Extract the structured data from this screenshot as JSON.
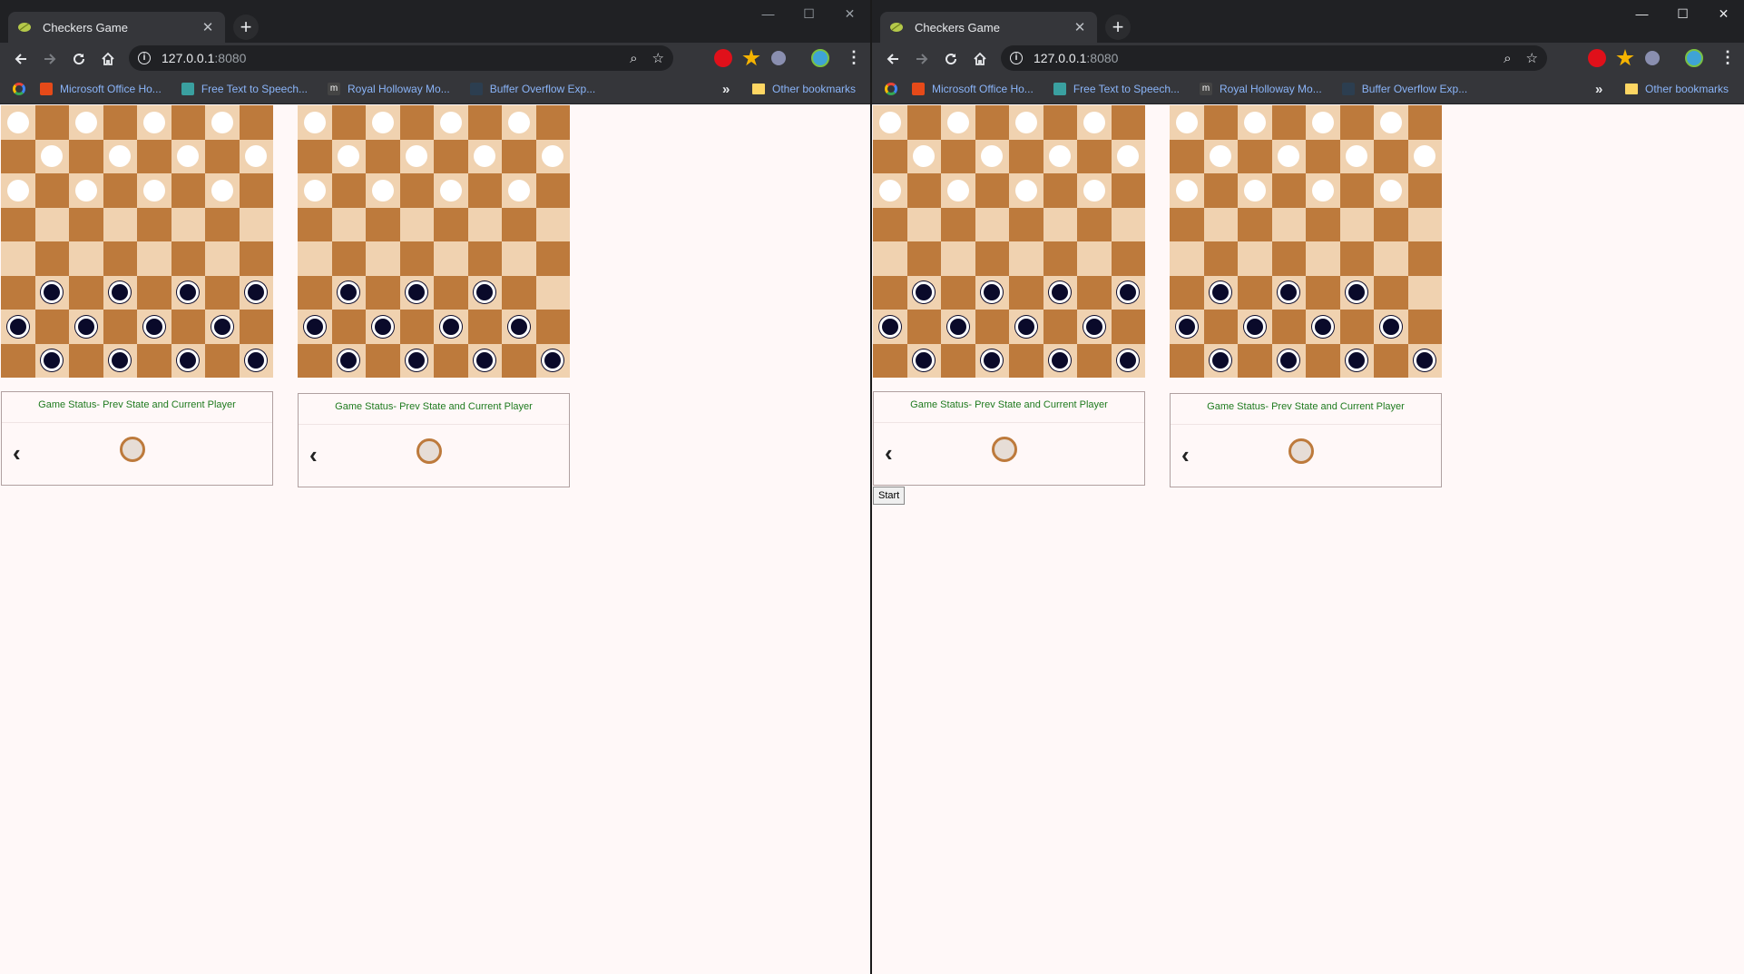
{
  "windows": [
    {
      "tab_title": "Checkers Game",
      "url_host": "127.0.0.1",
      "url_port": ":8080",
      "bookmarks": [
        "Microsoft Office Ho...",
        "Free Text to Speech...",
        "Royal Holloway Mo...",
        "Buffer Overflow Exp..."
      ],
      "other_bookmarks": "Other bookmarks",
      "status_title": "Game Status- Prev State and Current Player",
      "show_start": false
    },
    {
      "tab_title": "Checkers Game",
      "url_host": "127.0.0.1",
      "url_port": ":8080",
      "bookmarks": [
        "Microsoft Office Ho...",
        "Free Text to Speech...",
        "Royal Holloway Mo...",
        "Buffer Overflow Exp..."
      ],
      "other_bookmarks": "Other bookmarks",
      "status_title": "Game Status- Prev State and Current Player",
      "start_label": "Start",
      "show_start": true
    }
  ],
  "boards": {
    "board_a": [
      "w.w.w.w.",
      ".w.w.w.w",
      "w.w.w.w.",
      "........",
      "........",
      ".b.b.b.b",
      "b.b.b.b.",
      ".b.b.b.b"
    ],
    "board_b": [
      "w.w.w.w.",
      ".w.w.w.w",
      "w.w.w.w.",
      "........",
      "........",
      ".b.b.b..",
      "b.b.b.b.",
      ".b.b.b.b"
    ]
  },
  "colors": {
    "light_square": "#f0d2b0",
    "dark_square": "#bd7a3c",
    "white_piece": "#ffffff",
    "black_piece": "#0a0a2a",
    "status_text": "#1e7a1e"
  },
  "icons": [
    "back-arrow-icon",
    "forward-arrow-icon",
    "reload-icon",
    "home-icon",
    "zoom-icon",
    "star-icon",
    "more-icon",
    "chevron-left-icon",
    "folder-icon"
  ]
}
